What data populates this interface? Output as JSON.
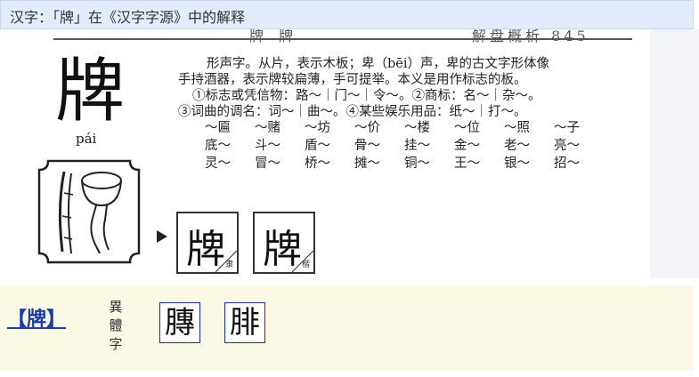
{
  "window": {
    "title": "汉字：「牌」在《汉字字源》中的解释"
  },
  "scan": {
    "header_fragment_left": "牌 牌",
    "header_fragment_right": "解盘概析 845",
    "headword": "牌",
    "pinyin": "pái",
    "text_lines": [
      "形声字。从片，表示木板；卑（bēi）声，卑的古文字形体像",
      "手持酒器，表示牌较扁薄，手可提举。本义是用作标志的板。",
      "①标志或凭信物：路～｜门～｜令～。②商标：名～｜杂～。",
      "③词曲的调名：词～｜曲～。④某些娱乐用品：纸～｜打～。"
    ],
    "word_rows": [
      [
        "～匾",
        "～赌",
        "～坊",
        "～价",
        "～楼",
        "～位",
        "～照",
        "～子"
      ],
      [
        "底～",
        "斗～",
        "盾～",
        "骨～",
        "挂～",
        "金～",
        "老～",
        "亮～"
      ],
      [
        "灵～",
        "冒～",
        "桥～",
        "摊～",
        "铜～",
        "王～",
        "银～",
        "招～"
      ]
    ],
    "script_forms": [
      {
        "glyph": "牌",
        "caption": "隶"
      },
      {
        "glyph": "牌",
        "caption": "楷"
      }
    ]
  },
  "variants": {
    "heading": "【牌】",
    "label": [
      "異",
      "體",
      "字"
    ],
    "glyphs": [
      "膞",
      "腓"
    ]
  },
  "colors": {
    "titlebar_bg": "#e3ecfa",
    "variants_bg": "#fbf9e5",
    "link_blue": "#1a3ab8"
  }
}
